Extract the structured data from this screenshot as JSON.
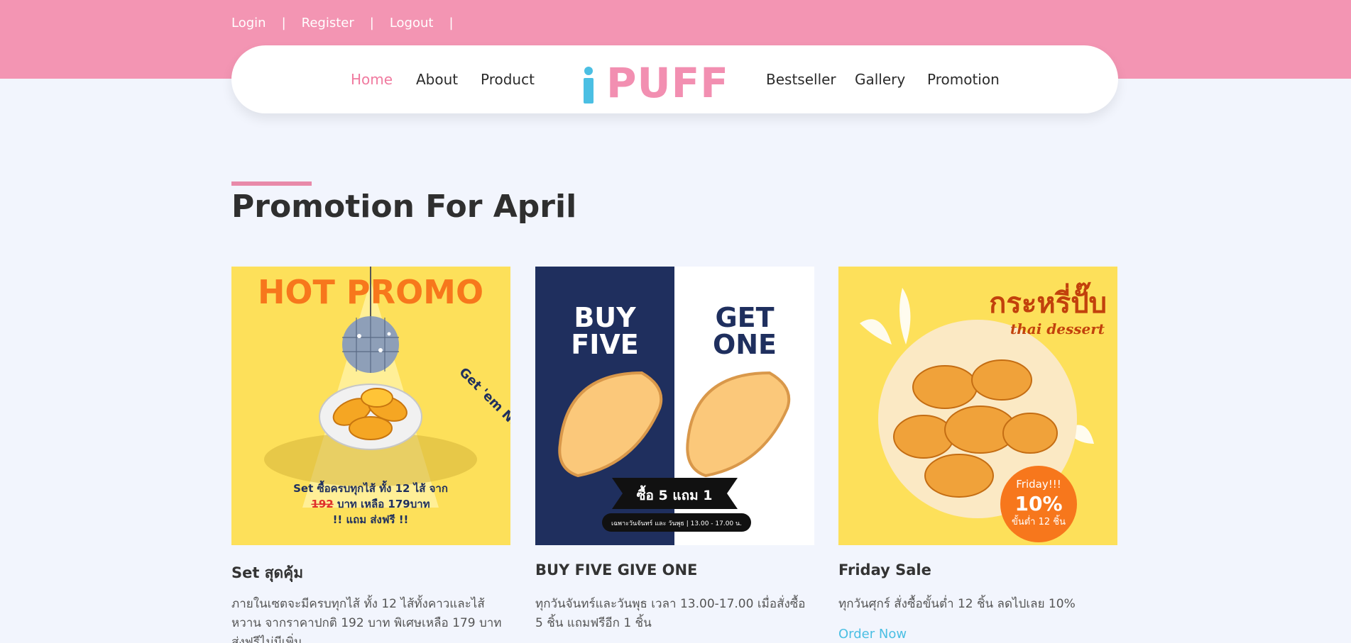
{
  "auth": {
    "login": "Login",
    "register": "Register",
    "logout": "Logout",
    "separator": "|"
  },
  "nav": {
    "left": [
      "Home",
      "About",
      "Product"
    ],
    "right": [
      "Bestseller",
      "Gallery",
      "Promotion"
    ],
    "active": "Home",
    "logo": {
      "i": "i",
      "text": "PUFF"
    }
  },
  "section": {
    "title": "Promotion For April"
  },
  "cards": [
    {
      "title": "Set สุดคุ้ม",
      "desc": "ภายในเซตจะมีครบทุกไส้ ทั้ง 12 ไส้ทั้งคาวและไส้หวาน จากราคาปกติ 192 บาท พิเศษเหลือ 179 บาท ส่งฟรีไม่มีเพิ่ม",
      "image": {
        "headline": "HOT PROMO",
        "side": "Get 'em Now!",
        "line1": "Set ซื้อครบทุกไส้ ทั้ง 12 ไส้ จาก",
        "old_price": "192",
        "line2": " บาท เหลือ 179บาท",
        "line3": "!! แถม ส่งฟรี !!"
      }
    },
    {
      "title": "BUY FIVE GIVE ONE",
      "desc": "ทุกวันจันทร์และวันพุธ เวลา 13.00-17.00 เมื่อสั่งซื้อ 5 ชิ้น แถมฟรีอีก 1 ชิ้น",
      "image": {
        "left_text": [
          "BUY",
          "FIVE"
        ],
        "right_text": [
          "GET",
          "ONE"
        ],
        "ribbon": "ซื้อ 5 แถม 1",
        "badge": "เฉพาะวันจันทร์ และ วันพุธ  |  13.00 - 17.00 น."
      }
    },
    {
      "title": "Friday Sale",
      "desc": "ทุกวันศุกร์ สั่งซื้อขั้นต่ำ 12 ชิ้น ลดไปเลย 10%",
      "order": "Order Now",
      "image": {
        "thai_title": "กระหรี่ปั๊บ",
        "subtitle": "thai dessert",
        "badge_line1": "Friday!!!",
        "badge_line2": "10%",
        "badge_line3": "ขั้นต่ำ 12 ชิ้น"
      }
    }
  ],
  "colors": {
    "band": "#f395b3",
    "page": "#f2f5fd",
    "accent_pink": "#f07a9f",
    "logo_blue": "#4bbfe3",
    "promo_yellow": "#fde05a",
    "navy": "#1f2f5e",
    "orange": "#f7771c"
  }
}
